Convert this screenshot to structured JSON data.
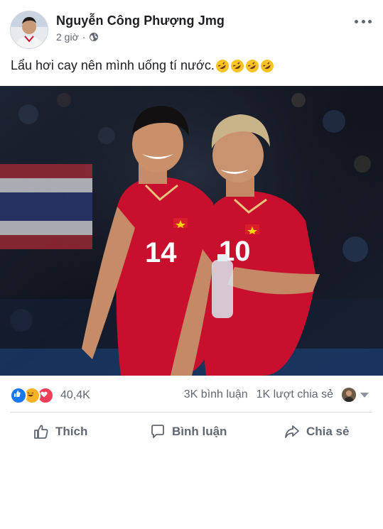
{
  "post": {
    "author": "Nguyễn Công Phượng Jmg",
    "time": "2 giờ",
    "separator": "·",
    "caption": "Lẩu hơi cay nên mình uống tí nước.",
    "caption_emoji_count": 4,
    "image": {
      "left_player_number": "14",
      "right_player_number": "10"
    }
  },
  "stats": {
    "reaction_count": "40,4K",
    "comments": "3K bình luận",
    "shares": "1K lượt chia sẻ"
  },
  "actions": {
    "like": "Thích",
    "comment": "Bình luận",
    "share": "Chia sẻ"
  },
  "colors": {
    "like_blue": "#1877f2",
    "love_red": "#f33e58",
    "haha_yellow": "#f7b125",
    "jersey_red": "#c8102e",
    "text_secondary": "#606770"
  },
  "icons": [
    "more-options-icon",
    "globe-icon",
    "rofl-emoji-icon",
    "like-reaction-icon",
    "haha-reaction-icon",
    "love-reaction-icon",
    "like-icon",
    "comment-icon",
    "share-icon"
  ]
}
